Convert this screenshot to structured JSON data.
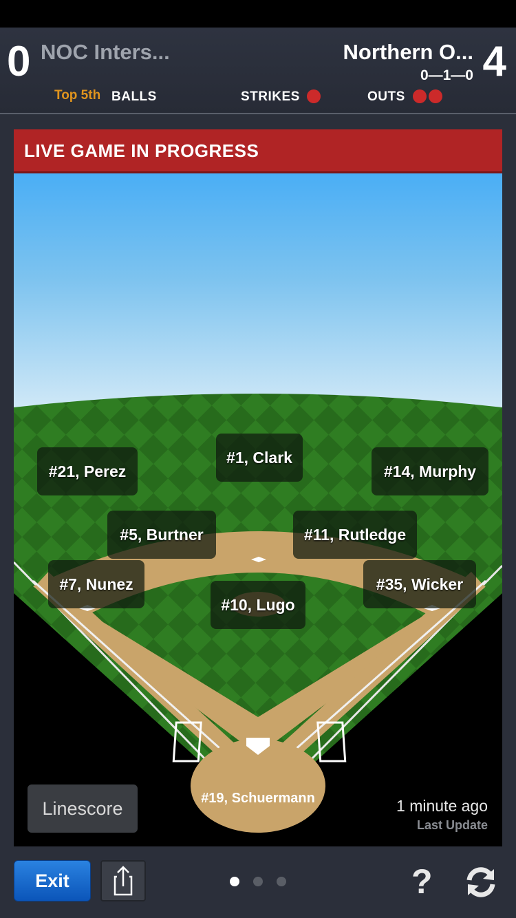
{
  "scoreboard": {
    "away_score": "0",
    "away_name": "NOC Inters...",
    "home_name": "Northern O...",
    "home_score": "4",
    "count": "0—1—0",
    "inning": "Top 5th",
    "balls_label": "BALLS",
    "strikes_label": "STRIKES",
    "outs_label": "OUTS",
    "strikes": 1,
    "outs": 2,
    "indicator_color": "#cc2a2a"
  },
  "banner": {
    "text": "LIVE GAME IN PROGRESS",
    "color": "#b02425"
  },
  "players": {
    "left_field": "#21, Perez",
    "center_field": "#1, Clark",
    "right_field": "#14, Murphy",
    "shortstop": "#5, Burtner",
    "second_base": "#11, Rutledge",
    "third_base": "#7, Nunez",
    "pitcher": "#10, Lugo",
    "first_base": "#35, Wicker",
    "batter": "#19, Schuermann"
  },
  "linescore_label": "Linescore",
  "last_update": {
    "time": "1 minute ago",
    "label": "Last Update"
  },
  "toolbar": {
    "exit_label": "Exit",
    "help_label": "?",
    "pages": 3,
    "current_page": 1,
    "share_icon": "share-icon",
    "refresh_icon": "refresh-icon"
  }
}
